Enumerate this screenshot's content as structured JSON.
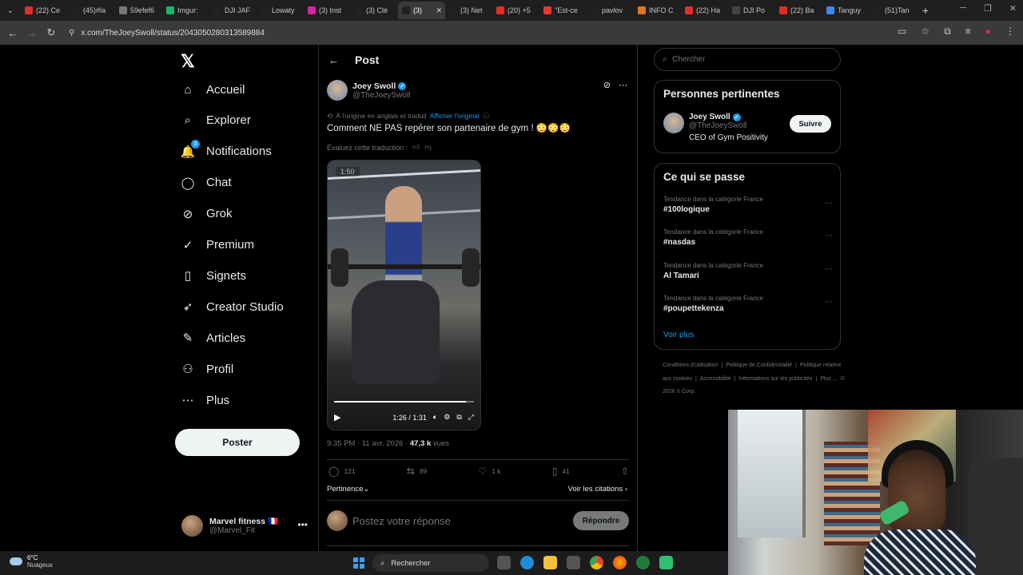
{
  "browser": {
    "tabs": [
      {
        "label": "(22) Ce",
        "fav": "youtube-icon",
        "color": "#e52d27"
      },
      {
        "label": "(45)#la",
        "fav": "tiktok-icon",
        "color": "#222222"
      },
      {
        "label": "59efef6",
        "fav": "globe-icon",
        "color": "#777777"
      },
      {
        "label": "Imgur:",
        "fav": "imgur-icon",
        "color": "#1bb76e"
      },
      {
        "label": "DJI JAF",
        "fav": "x-icon",
        "color": "#222222"
      },
      {
        "label": "Lowaty",
        "fav": "x-icon",
        "color": "#222222"
      },
      {
        "label": "(3) Inst",
        "fav": "instagram-icon",
        "color": "#d6249f"
      },
      {
        "label": "(3) Clé",
        "fav": "x-icon",
        "color": "#222222"
      },
      {
        "label": "(3)",
        "fav": "x-icon",
        "color": "#222222",
        "active": true
      },
      {
        "label": "(3) Net",
        "fav": "x-icon",
        "color": "#222222"
      },
      {
        "label": "(20) +5",
        "fav": "youtube-icon",
        "color": "#e52d27"
      },
      {
        "label": "\"Est-ce",
        "fav": "e-icon",
        "color": "#e63b2e"
      },
      {
        "label": "pavlov",
        "fav": "x-icon",
        "color": "#222222"
      },
      {
        "label": "INFO C",
        "fav": "rss-icon",
        "color": "#e8731e"
      },
      {
        "label": "(22) Ha",
        "fav": "youtube-icon",
        "color": "#e52d27"
      },
      {
        "label": "DJI Po",
        "fav": "dji-icon",
        "color": "#444444"
      },
      {
        "label": "(22) Ba",
        "fav": "youtube-icon",
        "color": "#e52d27"
      },
      {
        "label": "Tanguy",
        "fav": "google-icon",
        "color": "#4285f4"
      },
      {
        "label": "(51)Tan",
        "fav": "tiktok-icon",
        "color": "#222222"
      }
    ],
    "url": "x.com/TheJoeySwoll/status/2043050280313589884"
  },
  "sidebar": {
    "items": [
      {
        "label": "Accueil",
        "icon": "home-icon",
        "glyph": "⌂"
      },
      {
        "label": "Explorer",
        "icon": "search-icon",
        "glyph": "⌕"
      },
      {
        "label": "Notifications",
        "icon": "bell-icon",
        "glyph": "🔔",
        "badge": "3"
      },
      {
        "label": "Chat",
        "icon": "chat-icon",
        "glyph": "◯"
      },
      {
        "label": "Grok",
        "icon": "grok-icon",
        "glyph": "⊘"
      },
      {
        "label": "Premium",
        "icon": "premium-icon",
        "glyph": "✓"
      },
      {
        "label": "Signets",
        "icon": "bookmark-icon",
        "glyph": "▯"
      },
      {
        "label": "Creator Studio",
        "icon": "rocket-icon",
        "glyph": "➶"
      },
      {
        "label": "Articles",
        "icon": "article-icon",
        "glyph": "✎"
      },
      {
        "label": "Profil",
        "icon": "profile-icon",
        "glyph": "⚇"
      },
      {
        "label": "Plus",
        "icon": "more-icon",
        "glyph": "⋯"
      }
    ],
    "post_label": "Poster",
    "account": {
      "name": "Marvel fitness 🇫🇷",
      "handle": "@Marvel_Fit"
    }
  },
  "post": {
    "header_title": "Post",
    "author_name": "Joey Swoll",
    "author_handle": "@TheJoeySwoll",
    "translation_note": "À l'origine en anglais et traduit",
    "show_original": "Afficher l'original",
    "text": "Comment NE PAS repérer son partenaire de gym ! 😳😳😳",
    "rate_translation": "Évaluez cette traduction :",
    "video": {
      "timer": "1:50",
      "time": "1:26 / 1:31",
      "progress": 0.945
    },
    "time": "9:35 PM · 11 avr. 2026 ·",
    "views": "47,3 k",
    "views_label": "vues",
    "replies": "121",
    "reposts": "89",
    "likes": "1 k",
    "bookmarks": "41",
    "sort_label": "Pertinence",
    "quotes_label": "Voir les citations",
    "reply_placeholder": "Postez votre réponse",
    "reply_button": "Répondre"
  },
  "right": {
    "search_placeholder": "Chercher",
    "relevant_title": "Personnes pertinentes",
    "person": {
      "name": "Joey Swoll",
      "handle": "@TheJoeySwoll",
      "bio": "CEO of Gym Positivity",
      "follow": "Suivre"
    },
    "trending_title": "Ce qui se passe",
    "trends": [
      {
        "context": "Tendance dans la catégorie France",
        "tag": "#100logique"
      },
      {
        "context": "Tendance dans la catégorie France",
        "tag": "#nasdas"
      },
      {
        "context": "Tendance dans la catégorie France",
        "tag": "Al Tamari"
      },
      {
        "context": "Tendance dans la catégorie France",
        "tag": "#poupettekenza"
      }
    ],
    "see_more": "Voir plus",
    "footer": [
      "Conditions d'utilisation",
      "|",
      "Politique de Confidentialité",
      "|",
      "Politique relative aux cookies",
      "|",
      "Accessibilité",
      "|",
      "Informations sur les publicités",
      "|",
      "Plus ...",
      "© 2026 X Corp."
    ]
  },
  "taskbar": {
    "temp": "6°C",
    "weather": "Nuageux",
    "search": "Rechercher"
  }
}
